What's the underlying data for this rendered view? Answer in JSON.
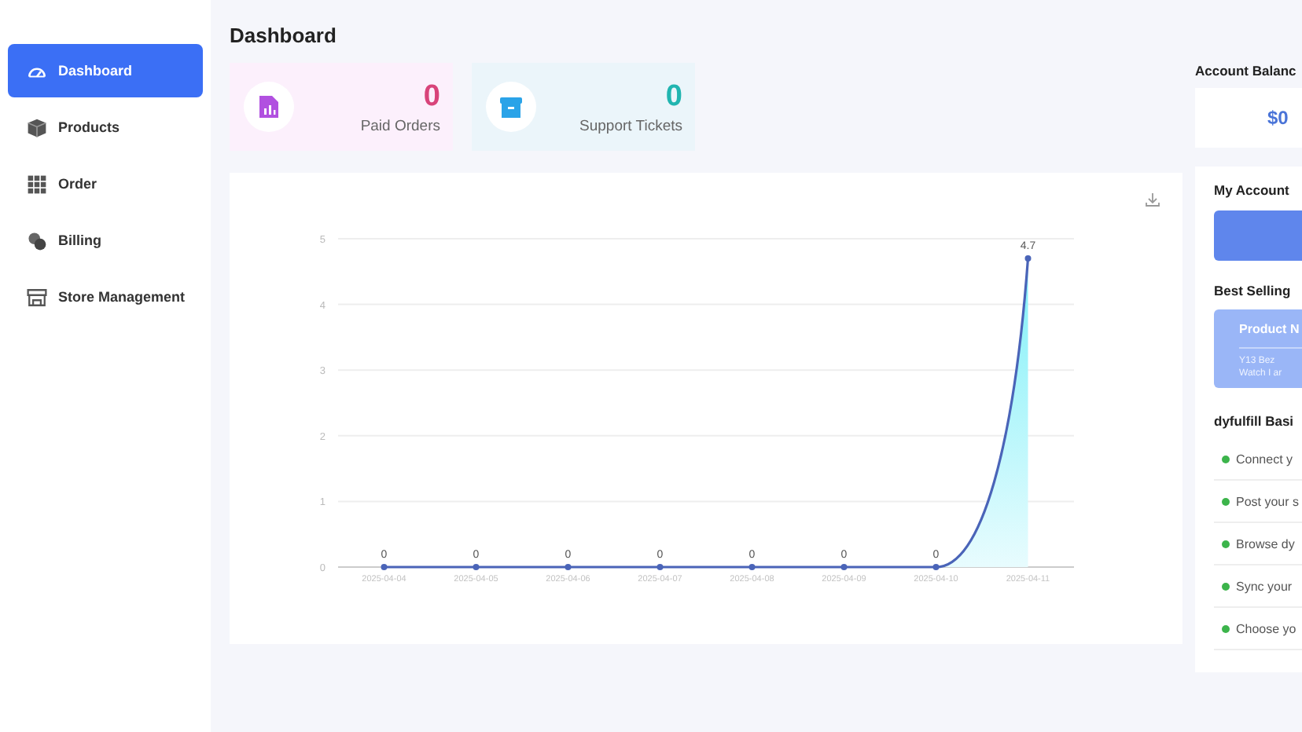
{
  "sidebar": {
    "items": [
      {
        "label": "Dashboard",
        "selected": true
      },
      {
        "label": "Products",
        "selected": false
      },
      {
        "label": "Order",
        "selected": false
      },
      {
        "label": "Billing",
        "selected": false
      },
      {
        "label": "Store Management",
        "selected": false
      }
    ]
  },
  "page_title": "Dashboard",
  "stats": [
    {
      "value": "0",
      "label": "Paid Orders",
      "kind": "orders",
      "color": "#d8447a"
    },
    {
      "value": "0",
      "label": "Support Tickets",
      "kind": "tickets",
      "color": "#21b5b0"
    }
  ],
  "chart": {
    "chart_data": {
      "type": "line",
      "grid": true,
      "categories": [
        "2025-04-04",
        "2025-04-05",
        "2025-04-06",
        "2025-04-07",
        "2025-04-08",
        "2025-04-09",
        "2025-04-10",
        "2025-04-11"
      ],
      "series": [
        {
          "color": "#4a64b8",
          "marker": true,
          "values": [
            0,
            0,
            0,
            0,
            0,
            0,
            0,
            4.7
          ]
        }
      ],
      "ylim": [
        0,
        5
      ],
      "yticks": [
        0,
        1,
        2,
        3,
        4,
        5
      ],
      "data_labels": true
    }
  },
  "account_balance": {
    "label": "Account Balanc",
    "value": "$0"
  },
  "my_account": {
    "title": "My Account"
  },
  "best_selling": {
    "title": "Best Selling",
    "product_heading": "Product N",
    "lines": [
      "Y13 Bez",
      "Watch I ar"
    ]
  },
  "basics": {
    "title": "dyfulfill Basi",
    "items": [
      "Connect y",
      "Post your s",
      "Browse dy",
      "Sync your",
      "Choose yo"
    ]
  }
}
